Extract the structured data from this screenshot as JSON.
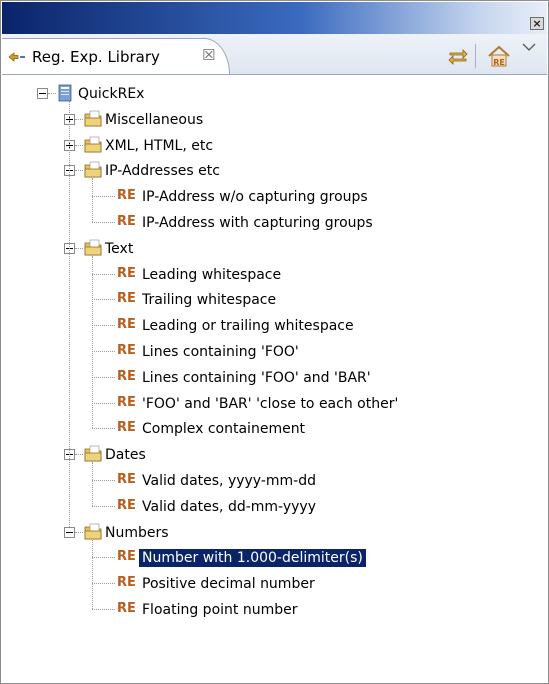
{
  "window": {
    "close_glyph": "×"
  },
  "view": {
    "tab_label": "Reg. Exp. Library",
    "tab_close_glyph": "☒",
    "toolbar_icons": [
      "sync-arrows-icon",
      "re-library-icon",
      "view-menu-chevron-icon"
    ]
  },
  "tree": {
    "root": {
      "label": "QuickREx",
      "expanded": true
    },
    "re_badge": "RE",
    "categories": [
      {
        "label": "Miscellaneous",
        "expanded": false,
        "items": []
      },
      {
        "label": "XML, HTML, etc",
        "expanded": false,
        "items": []
      },
      {
        "label": "IP-Addresses etc",
        "expanded": true,
        "items": [
          "IP-Address w/o capturing groups",
          "IP-Address with capturing groups"
        ]
      },
      {
        "label": "Text",
        "expanded": true,
        "items": [
          "Leading whitespace",
          "Trailing whitespace",
          "Leading or trailing whitespace",
          "Lines containing 'FOO'",
          "Lines containing 'FOO' and 'BAR'",
          "'FOO' and 'BAR' 'close to each other'",
          "Complex containement"
        ]
      },
      {
        "label": "Dates",
        "expanded": true,
        "items": [
          "Valid dates, yyyy-mm-dd",
          "Valid dates, dd-mm-yyyy"
        ]
      },
      {
        "label": "Numbers",
        "expanded": true,
        "items": [
          "Number with 1.000-delimiter(s)",
          "Positive decimal number",
          "Floating point number"
        ]
      }
    ],
    "selected_item": "Number with 1.000-delimiter(s)"
  },
  "colors": {
    "selection_bg": "#0a246a",
    "re_badge": "#b9601e",
    "folder": "#e8c05a"
  }
}
